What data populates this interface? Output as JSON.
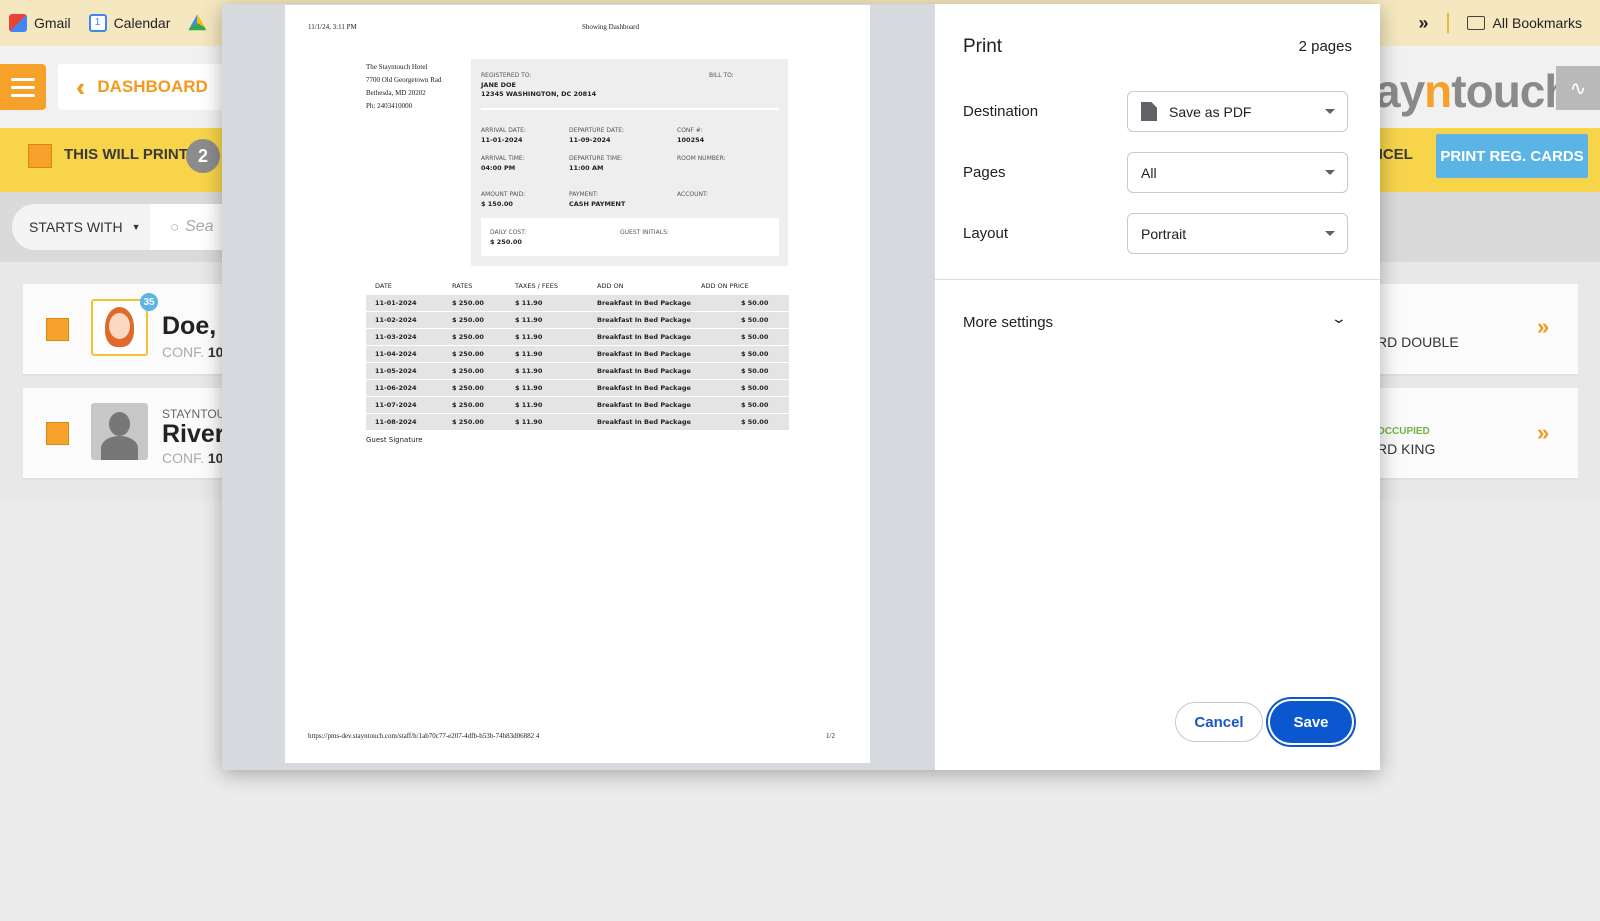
{
  "bookmarks": {
    "items": [
      {
        "label": "Gmail",
        "color": "#ea4335"
      },
      {
        "label": "Calendar",
        "color": "#4285f4"
      }
    ],
    "more_glyph": "»",
    "all_bookmarks": "All Bookmarks"
  },
  "app": {
    "dashboard": "DASHBOARD",
    "brand_pre": "ay",
    "brand_n": "n",
    "brand_post": "touch",
    "this_will_print": "THIS WILL PRINT",
    "print_count": "2",
    "cancel_partial": "NCEL",
    "print_reg_cards": "PRINT REG. CARDS",
    "starts_with": "STARTS WITH",
    "search_placeholder": "Sea",
    "accent": "#f5a12a",
    "toolbar_color": "#f7d44a"
  },
  "guests": [
    {
      "hotel": "",
      "name": "Doe,",
      "conf_label": "CONF.",
      "conf_value": "10",
      "nights": "35",
      "status": "",
      "room": "RD DOUBLE"
    },
    {
      "hotel": "STAYNTOU",
      "name": "River",
      "conf_label": "CONF.",
      "conf_value": "10",
      "nights": "",
      "status": "OCCUPIED",
      "room": "RD KING"
    }
  ],
  "sheet": {
    "timestamp": "11/1/24, 3:11 PM",
    "header_title": "Showing Dashboard",
    "hotel": {
      "name": "The Stayntouch Hotel",
      "street": "7700 Old Georgetown Rad",
      "city": "Bethesda, MD 20202",
      "phone": "Ph: 2403410000"
    },
    "registered_to_label": "REGISTERED TO:",
    "registered_name": "JANE DOE",
    "registered_address": "12345 WASHINGTON, DC 20814",
    "bill_to_label": "BILL TO:",
    "arrival_date_label": "ARRIVAL DATE:",
    "arrival_date": "11-01-2024",
    "departure_date_label": "DEPARTURE DATE:",
    "departure_date": "11-09-2024",
    "conf_label": "CONF #:",
    "conf": "100254",
    "arrival_time_label": "ARRIVAL TIME:",
    "arrival_time": "04:00 PM",
    "departure_time_label": "DEPARTURE TIME:",
    "departure_time": "11:00 AM",
    "room_number_label": "ROOM NUMBER:",
    "amount_paid_label": "AMOUNT PAID:",
    "amount_paid": "$ 150.00",
    "payment_label": "PAYMENT:",
    "payment": "CASH PAYMENT",
    "account_label": "ACCOUNT:",
    "daily_cost_label": "DAILY COST:",
    "daily_cost": "$ 250.00",
    "guest_initials_label": "GUEST INITIALS:",
    "table_headers": [
      "DATE",
      "RATES",
      "TAXES / FEES",
      "ADD ON",
      "ADD ON PRICE"
    ],
    "rows": [
      [
        "11-01-2024",
        "$ 250.00",
        "$ 11.90",
        "Breakfast In Bed Package",
        "$ 50.00"
      ],
      [
        "11-02-2024",
        "$ 250.00",
        "$ 11.90",
        "Breakfast In Bed Package",
        "$ 50.00"
      ],
      [
        "11-03-2024",
        "$ 250.00",
        "$ 11.90",
        "Breakfast In Bed Package",
        "$ 50.00"
      ],
      [
        "11-04-2024",
        "$ 250.00",
        "$ 11.90",
        "Breakfast In Bed Package",
        "$ 50.00"
      ],
      [
        "11-05-2024",
        "$ 250.00",
        "$ 11.90",
        "Breakfast In Bed Package",
        "$ 50.00"
      ],
      [
        "11-06-2024",
        "$ 250.00",
        "$ 11.90",
        "Breakfast In Bed Package",
        "$ 50.00"
      ],
      [
        "11-07-2024",
        "$ 250.00",
        "$ 11.90",
        "Breakfast In Bed Package",
        "$ 50.00"
      ],
      [
        "11-08-2024",
        "$ 250.00",
        "$ 11.90",
        "Breakfast In Bed Package",
        "$ 50.00"
      ]
    ],
    "guest_signature": "Guest Signature",
    "footer_url": "https://pms-dev.stayntouch.com/staff/h/1ab70c77-e207-4dfb-b53b-74b83d06882 4",
    "page_number": "1/2"
  },
  "print": {
    "title": "Print",
    "pages_count": "2 pages",
    "destination_label": "Destination",
    "destination_value": "Save as PDF",
    "pages_label": "Pages",
    "pages_value": "All",
    "layout_label": "Layout",
    "layout_value": "Portrait",
    "more_settings": "More settings",
    "cancel": "Cancel",
    "save": "Save",
    "save_color": "#0b57d0"
  }
}
